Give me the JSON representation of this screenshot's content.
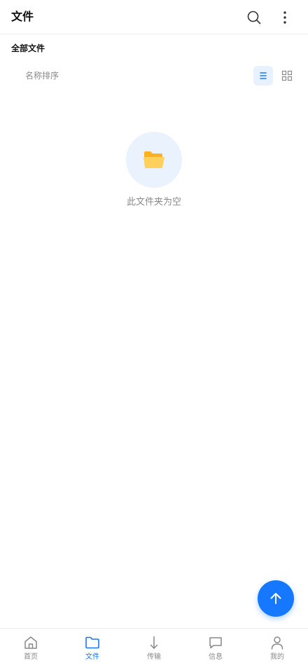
{
  "header": {
    "title": "文件",
    "search_icon": "search-icon",
    "more_icon": "more-vertical-icon"
  },
  "breadcrumb": {
    "label": "全部文件"
  },
  "toolbar": {
    "sort_label": "名称排序",
    "view_modes": [
      {
        "name": "list-view",
        "icon": "list-icon",
        "selected": true
      },
      {
        "name": "grid-view",
        "icon": "grid-icon",
        "selected": false
      }
    ]
  },
  "empty_state": {
    "icon": "folder-open-icon",
    "message": "此文件夹为空"
  },
  "fab": {
    "icon": "arrow-up-icon"
  },
  "bottom_nav": {
    "items": [
      {
        "label": "首页",
        "icon": "home-icon",
        "active": false
      },
      {
        "label": "文件",
        "icon": "folder-icon",
        "active": true
      },
      {
        "label": "传输",
        "icon": "download-arrow-icon",
        "active": false
      },
      {
        "label": "信息",
        "icon": "message-icon",
        "active": false
      },
      {
        "label": "我的",
        "icon": "user-icon",
        "active": false
      }
    ]
  },
  "colors": {
    "accent": "#1677ff",
    "muted_text": "#8a8a8a",
    "empty_circle_bg": "#eaf2fd",
    "folder_yellow": "#ffc94d"
  }
}
